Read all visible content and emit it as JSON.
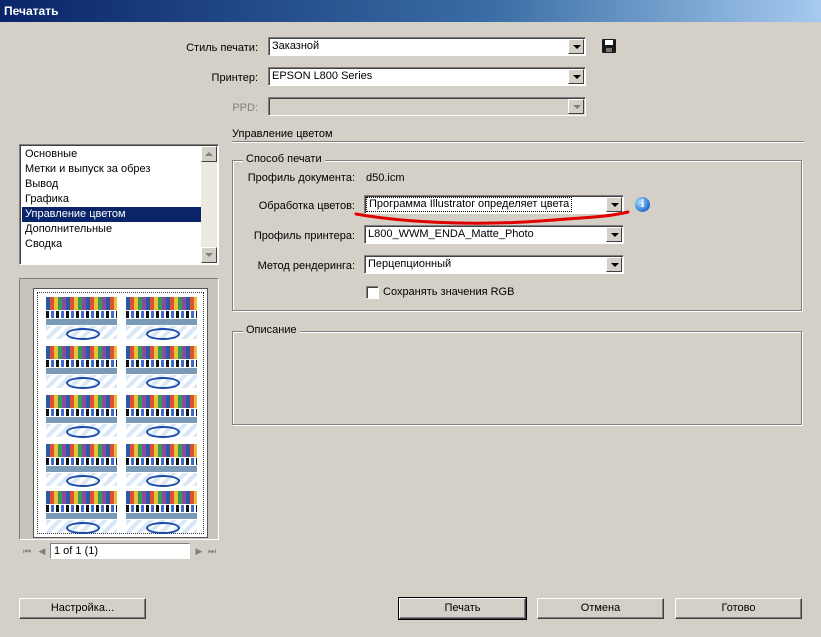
{
  "window": {
    "title": "Печатать"
  },
  "top": {
    "print_preset_label": "Стиль печати:",
    "print_preset_value": "Заказной",
    "printer_label": "Принтер:",
    "printer_value": "EPSON L800 Series",
    "ppd_label": "PPD:",
    "ppd_value": "",
    "section_title": "Управление цветом"
  },
  "categories": [
    {
      "label": "Основные"
    },
    {
      "label": "Метки и выпуск за обрез"
    },
    {
      "label": "Вывод"
    },
    {
      "label": "Графика"
    },
    {
      "label": "Управление цветом"
    },
    {
      "label": "Дополнительные"
    },
    {
      "label": "Сводка"
    }
  ],
  "selected_category": "Управление цветом",
  "print_method": {
    "group_title": "Способ печати",
    "doc_profile_label": "Профиль документа:",
    "doc_profile_value": "d50.icm",
    "color_handling_label": "Обработка цветов:",
    "color_handling_value": "Программа Illustrator определяет цвета",
    "printer_profile_label": "Профиль принтера:",
    "printer_profile_value": "L800_WWM_ENDA_Matte_Photo",
    "rendering_intent_label": "Метод рендеринга:",
    "rendering_intent_value": "Перцепционный",
    "preserve_rgb_label": "Сохранять значения RGB",
    "preserve_rgb_checked": false
  },
  "description": {
    "group_title": "Описание"
  },
  "preview": {
    "page_indicator": "1 of 1 (1)"
  },
  "buttons": {
    "setup": "Настройка...",
    "print": "Печать",
    "cancel": "Отмена",
    "done": "Готово"
  },
  "annotation": {
    "color": "#e00000",
    "kind": "hand-drawn underline"
  },
  "icons": {
    "save_preset": "save-icon",
    "info": "info-icon"
  }
}
